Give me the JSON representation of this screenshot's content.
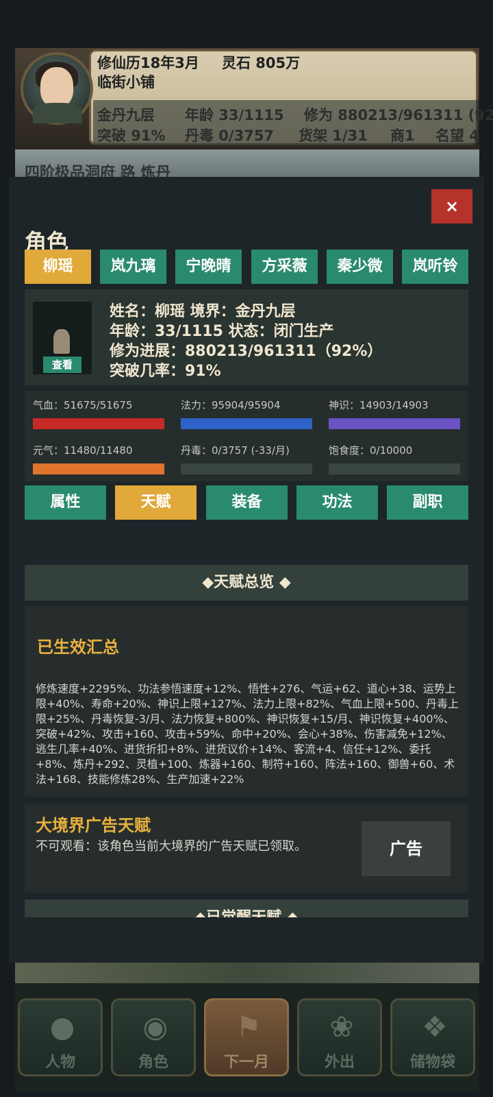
{
  "header": {
    "date": "修仙历18年3月",
    "spirit_stones": "灵石 805万",
    "shop_name": "临街小铺",
    "stats_row1": [
      "金丹九层",
      "年龄 33/1115",
      "修为 880213/961311 (92"
    ],
    "stats_row2": [
      "突破 91%",
      "丹毒 0/3757",
      "货架 1/31",
      "商1",
      "名望 4"
    ],
    "scene_text": "四阶极品洞府 路 炼丹"
  },
  "panel": {
    "close_label": "×",
    "title": "角色",
    "character_tabs": [
      {
        "label": "柳瑶",
        "active": true
      },
      {
        "label": "岚九璃",
        "active": false
      },
      {
        "label": "宁晚晴",
        "active": false
      },
      {
        "label": "方采薇",
        "active": false
      },
      {
        "label": "秦少微",
        "active": false
      },
      {
        "label": "岚听铃",
        "active": false
      }
    ],
    "info": {
      "view_label": "查看",
      "line1": "姓名：柳瑶    境界：金丹九层",
      "line2": "年龄：33/1115    状态：闭门生产",
      "line3": "修为进展：880213/961311（92%）",
      "line4": "突破几率：91%"
    },
    "bars": [
      {
        "label": "气血：51675/51675",
        "fraction": 1.0,
        "color": "#c62a26"
      },
      {
        "label": "法力：95904/95904",
        "fraction": 1.0,
        "color": "#2f62c9"
      },
      {
        "label": "神识：14903/14903",
        "fraction": 1.0,
        "color": "#6a52c2"
      },
      {
        "label": "元气：11480/11480",
        "fraction": 1.0,
        "color": "#e0742e"
      },
      {
        "label": "丹毒：0/3757 (-33/月)",
        "fraction": 0.0,
        "color": "#8a8a8a"
      },
      {
        "label": "饱食度：0/10000",
        "fraction": 0.0,
        "color": "#8a8a8a"
      }
    ],
    "section_tabs": [
      {
        "label": "属性",
        "active": false
      },
      {
        "label": "天赋",
        "active": true
      },
      {
        "label": "装备",
        "active": false
      },
      {
        "label": "功法",
        "active": false
      },
      {
        "label": "副职",
        "active": false
      }
    ],
    "overview_title": "◆天赋总览 ◆",
    "effects": {
      "title": "已生效汇总",
      "text": "修炼速度+2295%、功法参悟速度+12%、悟性+276、气运+62、道心+38、运势上限+40%、寿命+20%、神识上限+127%、法力上限+82%、气血上限+500、丹毒上限+25%、丹毒恢复-3/月、法力恢复+800%、神识恢复+15/月、神识恢复+400%、突破+42%、攻击+160、攻击+59%、命中+20%、会心+38%、伤害减免+12%、逃生几率+40%、进货折扣+8%、进货议价+14%、客流+4、信任+12%、委托+8%、炼丹+292、灵植+100、炼器+160、制符+160、阵法+160、御兽+60、术法+168、技能修炼28%、生产加速+22%"
    },
    "ad_talent": {
      "title": "大境界广告天赋",
      "desc": "不可观看：该角色当前大境界的广告天赋已领取。",
      "button": "广告"
    },
    "awakened_title": "◆已觉醒天赋 ◆"
  },
  "bottom_nav": [
    {
      "label": "人物",
      "icon": "person-icon",
      "active": false
    },
    {
      "label": "角色",
      "icon": "character-icon",
      "active": false
    },
    {
      "label": "下一月",
      "icon": "flag-icon",
      "active": true
    },
    {
      "label": "外出",
      "icon": "lotus-icon",
      "active": false
    },
    {
      "label": "储物袋",
      "icon": "bag-icon",
      "active": false
    }
  ]
}
